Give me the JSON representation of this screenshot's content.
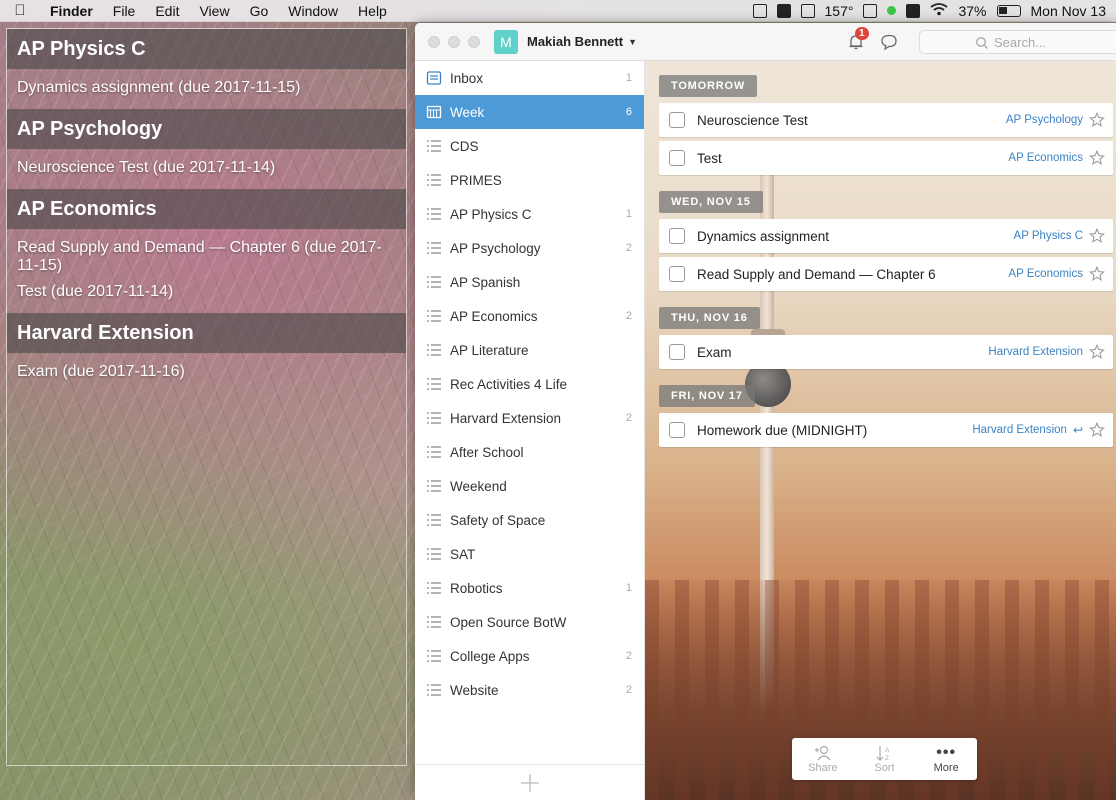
{
  "menubar": {
    "apple": "",
    "app": "Finder",
    "items": [
      "File",
      "Edit",
      "View",
      "Go",
      "Window",
      "Help"
    ],
    "temperature": "157°",
    "battery": "37%",
    "datetime": "Mon Nov 13"
  },
  "widget": {
    "groups": [
      {
        "heading": "AP Physics C",
        "items": [
          "Dynamics assignment (due 2017-11-15)"
        ]
      },
      {
        "heading": "AP Psychology",
        "items": [
          "Neuroscience Test (due 2017-11-14)"
        ]
      },
      {
        "heading": "AP Economics",
        "items": [
          "Read Supply and Demand — Chapter 6 (due 2017-11-15)",
          "Test (due 2017-11-14)"
        ]
      },
      {
        "heading": "Harvard Extension",
        "items": [
          "Exam (due 2017-11-16)"
        ]
      }
    ]
  },
  "window": {
    "user": {
      "initial": "M",
      "name": "Makiah Bennett"
    },
    "notifications_badge": "1",
    "search": {
      "placeholder": "Search..."
    }
  },
  "sidebar": {
    "items": [
      {
        "label": "Inbox",
        "count": "1",
        "icon": "inbox-icon"
      },
      {
        "label": "Week",
        "count": "6",
        "icon": "calendar-week-icon",
        "active": true
      },
      {
        "label": "CDS",
        "count": "",
        "icon": "list-icon"
      },
      {
        "label": "PRIMES",
        "count": "",
        "icon": "list-icon"
      },
      {
        "label": "AP Physics C",
        "count": "1",
        "icon": "list-icon"
      },
      {
        "label": "AP Psychology",
        "count": "2",
        "icon": "list-icon"
      },
      {
        "label": "AP Spanish",
        "count": "",
        "icon": "list-icon"
      },
      {
        "label": "AP Economics",
        "count": "2",
        "icon": "list-icon"
      },
      {
        "label": "AP Literature",
        "count": "",
        "icon": "list-icon"
      },
      {
        "label": "Rec Activities 4 Life",
        "count": "",
        "icon": "list-icon"
      },
      {
        "label": "Harvard Extension",
        "count": "2",
        "icon": "list-icon"
      },
      {
        "label": "After School",
        "count": "",
        "icon": "list-icon"
      },
      {
        "label": "Weekend",
        "count": "",
        "icon": "list-icon"
      },
      {
        "label": "Safety of Space",
        "count": "",
        "icon": "list-icon"
      },
      {
        "label": "SAT",
        "count": "",
        "icon": "list-icon"
      },
      {
        "label": "Robotics",
        "count": "1",
        "icon": "list-icon"
      },
      {
        "label": "Open Source BotW",
        "count": "",
        "icon": "list-icon"
      },
      {
        "label": "College Apps",
        "count": "2",
        "icon": "list-icon"
      },
      {
        "label": "Website",
        "count": "2",
        "icon": "list-icon"
      }
    ]
  },
  "sections": [
    {
      "label": "TOMORROW",
      "tasks": [
        {
          "title": "Neuroscience Test",
          "list": "AP Psychology",
          "repeat": false
        },
        {
          "title": "Test",
          "list": "AP Economics",
          "repeat": false
        }
      ]
    },
    {
      "label": "WED, NOV 15",
      "tasks": [
        {
          "title": "Dynamics assignment",
          "list": "AP Physics C",
          "repeat": false
        },
        {
          "title": "Read Supply and Demand — Chapter 6",
          "list": "AP Economics",
          "repeat": false
        }
      ]
    },
    {
      "label": "THU, NOV 16",
      "tasks": [
        {
          "title": "Exam",
          "list": "Harvard Extension",
          "repeat": false
        }
      ]
    },
    {
      "label": "FRI, NOV 17",
      "tasks": [
        {
          "title": "Homework due (MIDNIGHT)",
          "list": "Harvard Extension",
          "repeat": true
        }
      ]
    }
  ],
  "bottombar": {
    "share": "Share",
    "sort": "Sort",
    "more": "More"
  }
}
